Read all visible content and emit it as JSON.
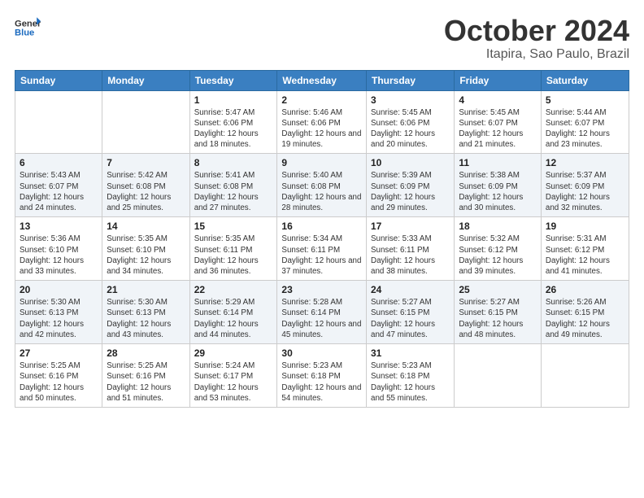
{
  "header": {
    "logo_general": "General",
    "logo_blue": "Blue",
    "month": "October 2024",
    "location": "Itapira, Sao Paulo, Brazil"
  },
  "days_of_week": [
    "Sunday",
    "Monday",
    "Tuesday",
    "Wednesday",
    "Thursday",
    "Friday",
    "Saturday"
  ],
  "weeks": [
    [
      {
        "day": "",
        "info": ""
      },
      {
        "day": "",
        "info": ""
      },
      {
        "day": "1",
        "info": "Sunrise: 5:47 AM\nSunset: 6:06 PM\nDaylight: 12 hours and 18 minutes."
      },
      {
        "day": "2",
        "info": "Sunrise: 5:46 AM\nSunset: 6:06 PM\nDaylight: 12 hours and 19 minutes."
      },
      {
        "day": "3",
        "info": "Sunrise: 5:45 AM\nSunset: 6:06 PM\nDaylight: 12 hours and 20 minutes."
      },
      {
        "day": "4",
        "info": "Sunrise: 5:45 AM\nSunset: 6:07 PM\nDaylight: 12 hours and 21 minutes."
      },
      {
        "day": "5",
        "info": "Sunrise: 5:44 AM\nSunset: 6:07 PM\nDaylight: 12 hours and 23 minutes."
      }
    ],
    [
      {
        "day": "6",
        "info": "Sunrise: 5:43 AM\nSunset: 6:07 PM\nDaylight: 12 hours and 24 minutes."
      },
      {
        "day": "7",
        "info": "Sunrise: 5:42 AM\nSunset: 6:08 PM\nDaylight: 12 hours and 25 minutes."
      },
      {
        "day": "8",
        "info": "Sunrise: 5:41 AM\nSunset: 6:08 PM\nDaylight: 12 hours and 27 minutes."
      },
      {
        "day": "9",
        "info": "Sunrise: 5:40 AM\nSunset: 6:08 PM\nDaylight: 12 hours and 28 minutes."
      },
      {
        "day": "10",
        "info": "Sunrise: 5:39 AM\nSunset: 6:09 PM\nDaylight: 12 hours and 29 minutes."
      },
      {
        "day": "11",
        "info": "Sunrise: 5:38 AM\nSunset: 6:09 PM\nDaylight: 12 hours and 30 minutes."
      },
      {
        "day": "12",
        "info": "Sunrise: 5:37 AM\nSunset: 6:09 PM\nDaylight: 12 hours and 32 minutes."
      }
    ],
    [
      {
        "day": "13",
        "info": "Sunrise: 5:36 AM\nSunset: 6:10 PM\nDaylight: 12 hours and 33 minutes."
      },
      {
        "day": "14",
        "info": "Sunrise: 5:35 AM\nSunset: 6:10 PM\nDaylight: 12 hours and 34 minutes."
      },
      {
        "day": "15",
        "info": "Sunrise: 5:35 AM\nSunset: 6:11 PM\nDaylight: 12 hours and 36 minutes."
      },
      {
        "day": "16",
        "info": "Sunrise: 5:34 AM\nSunset: 6:11 PM\nDaylight: 12 hours and 37 minutes."
      },
      {
        "day": "17",
        "info": "Sunrise: 5:33 AM\nSunset: 6:11 PM\nDaylight: 12 hours and 38 minutes."
      },
      {
        "day": "18",
        "info": "Sunrise: 5:32 AM\nSunset: 6:12 PM\nDaylight: 12 hours and 39 minutes."
      },
      {
        "day": "19",
        "info": "Sunrise: 5:31 AM\nSunset: 6:12 PM\nDaylight: 12 hours and 41 minutes."
      }
    ],
    [
      {
        "day": "20",
        "info": "Sunrise: 5:30 AM\nSunset: 6:13 PM\nDaylight: 12 hours and 42 minutes."
      },
      {
        "day": "21",
        "info": "Sunrise: 5:30 AM\nSunset: 6:13 PM\nDaylight: 12 hours and 43 minutes."
      },
      {
        "day": "22",
        "info": "Sunrise: 5:29 AM\nSunset: 6:14 PM\nDaylight: 12 hours and 44 minutes."
      },
      {
        "day": "23",
        "info": "Sunrise: 5:28 AM\nSunset: 6:14 PM\nDaylight: 12 hours and 45 minutes."
      },
      {
        "day": "24",
        "info": "Sunrise: 5:27 AM\nSunset: 6:15 PM\nDaylight: 12 hours and 47 minutes."
      },
      {
        "day": "25",
        "info": "Sunrise: 5:27 AM\nSunset: 6:15 PM\nDaylight: 12 hours and 48 minutes."
      },
      {
        "day": "26",
        "info": "Sunrise: 5:26 AM\nSunset: 6:15 PM\nDaylight: 12 hours and 49 minutes."
      }
    ],
    [
      {
        "day": "27",
        "info": "Sunrise: 5:25 AM\nSunset: 6:16 PM\nDaylight: 12 hours and 50 minutes."
      },
      {
        "day": "28",
        "info": "Sunrise: 5:25 AM\nSunset: 6:16 PM\nDaylight: 12 hours and 51 minutes."
      },
      {
        "day": "29",
        "info": "Sunrise: 5:24 AM\nSunset: 6:17 PM\nDaylight: 12 hours and 53 minutes."
      },
      {
        "day": "30",
        "info": "Sunrise: 5:23 AM\nSunset: 6:18 PM\nDaylight: 12 hours and 54 minutes."
      },
      {
        "day": "31",
        "info": "Sunrise: 5:23 AM\nSunset: 6:18 PM\nDaylight: 12 hours and 55 minutes."
      },
      {
        "day": "",
        "info": ""
      },
      {
        "day": "",
        "info": ""
      }
    ]
  ]
}
